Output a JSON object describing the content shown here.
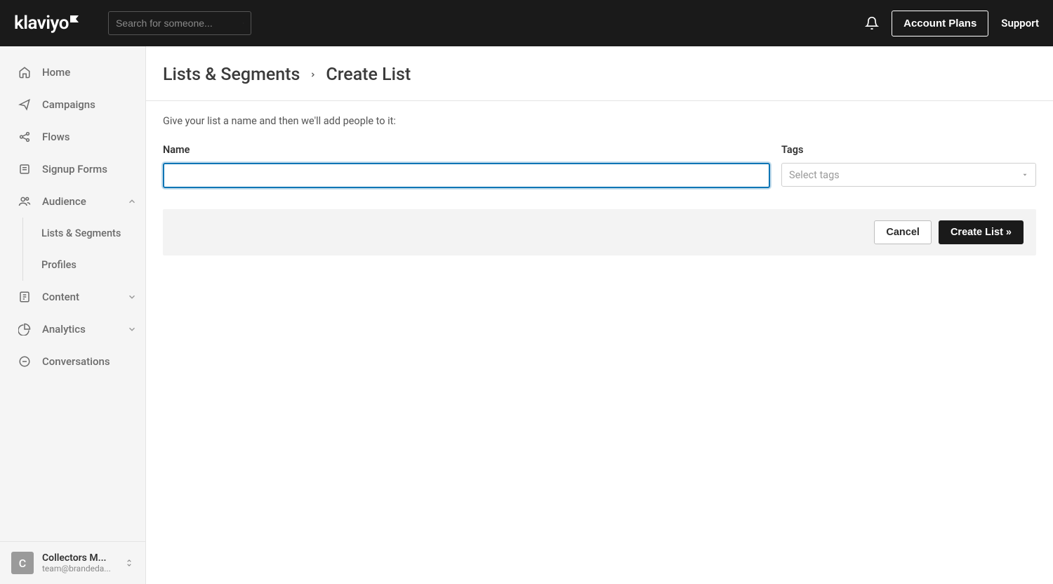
{
  "header": {
    "logo_text": "klaviyo",
    "search_placeholder": "Search for someone...",
    "account_plans_label": "Account Plans",
    "support_label": "Support"
  },
  "sidebar": {
    "items": [
      {
        "label": "Home",
        "icon": "home"
      },
      {
        "label": "Campaigns",
        "icon": "send"
      },
      {
        "label": "Flows",
        "icon": "share"
      },
      {
        "label": "Signup Forms",
        "icon": "form"
      },
      {
        "label": "Audience",
        "icon": "users",
        "expanded": true
      },
      {
        "label": "Content",
        "icon": "content",
        "expandable": true
      },
      {
        "label": "Analytics",
        "icon": "pie",
        "expandable": true
      },
      {
        "label": "Conversations",
        "icon": "chat"
      }
    ],
    "audience_sub": [
      {
        "label": "Lists & Segments"
      },
      {
        "label": "Profiles"
      }
    ],
    "account": {
      "initial": "C",
      "name": "Collectors M...",
      "email": "team@brandeda..."
    }
  },
  "page": {
    "breadcrumb_parent": "Lists & Segments",
    "breadcrumb_current": "Create List",
    "helper": "Give your list a name and then we'll add people to it:",
    "name_label": "Name",
    "name_value": "",
    "tags_label": "Tags",
    "tags_placeholder": "Select tags",
    "cancel_label": "Cancel",
    "submit_label": "Create List »"
  }
}
